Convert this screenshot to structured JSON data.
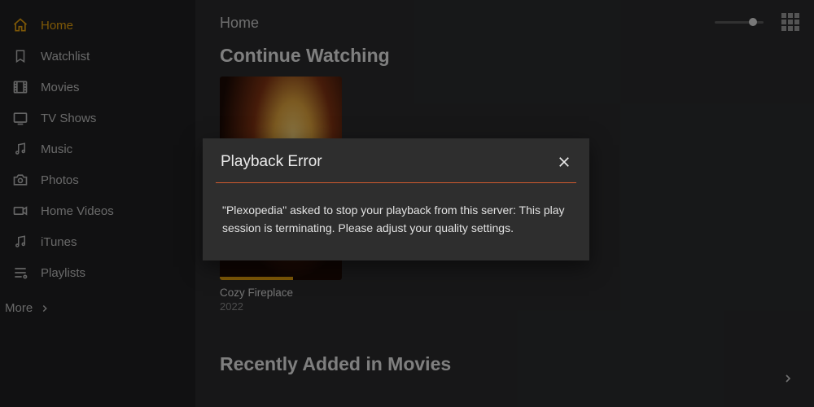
{
  "sidebar": {
    "items": [
      {
        "label": "Home"
      },
      {
        "label": "Watchlist"
      },
      {
        "label": "Movies"
      },
      {
        "label": "TV Shows"
      },
      {
        "label": "Music"
      },
      {
        "label": "Photos"
      },
      {
        "label": "Home Videos"
      },
      {
        "label": "iTunes"
      },
      {
        "label": "Playlists"
      }
    ],
    "more_label": "More"
  },
  "main": {
    "breadcrumb": "Home",
    "continue_title": "Continue Watching",
    "recent_title": "Recently Added in Movies",
    "items": [
      {
        "title": "Cozy Fireplace",
        "year": "2022"
      }
    ]
  },
  "dialog": {
    "title": "Playback Error",
    "body": "\"Plexopedia\" asked to stop your playback from this server: This play session is terminating. Please adjust your quality settings."
  }
}
